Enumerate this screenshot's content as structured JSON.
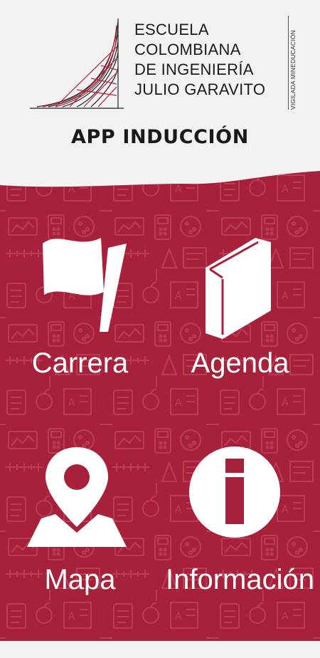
{
  "institution": {
    "lines": [
      "Escuela",
      "Colombiana",
      "de Ingeniería",
      "Julio Garavito"
    ],
    "vigilada": "VIGILADA MINEDUCACIÓN"
  },
  "app_title": "APP INDUCCIÓN",
  "theme": {
    "header_bg": "#f2f2f2",
    "panel_bg": "#a8213a",
    "pattern_color": "#c74a5f",
    "text_color": "#ffffff"
  },
  "menu": [
    {
      "label": "Carrera",
      "icon": "flag-icon"
    },
    {
      "label": "Agenda",
      "icon": "book-icon"
    },
    {
      "label": "Mapa",
      "icon": "map-pin-icon"
    },
    {
      "label": "Información",
      "icon": "info-icon"
    }
  ]
}
